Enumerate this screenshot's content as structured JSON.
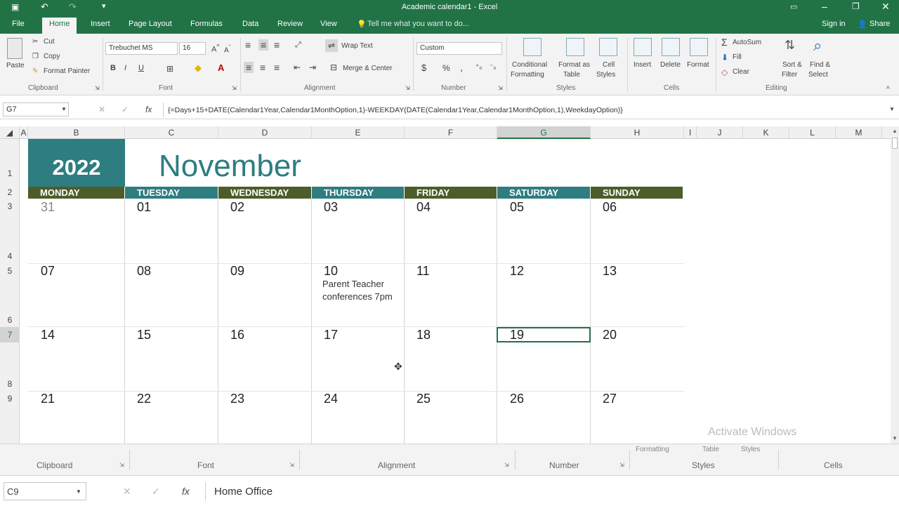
{
  "window": {
    "title": "Academic calendar1 - Excel"
  },
  "tabs": [
    "File",
    "Home",
    "Insert",
    "Page Layout",
    "Formulas",
    "Data",
    "Review",
    "View"
  ],
  "tell_me": "Tell me what you want to do...",
  "account": {
    "signin": "Sign in",
    "share": "Share"
  },
  "ribbon": {
    "clipboard": {
      "paste": "Paste",
      "cut": "Cut",
      "copy": "Copy",
      "format_painter": "Format Painter",
      "label": "Clipboard"
    },
    "font": {
      "name": "Trebuchet MS",
      "size": "16",
      "label": "Font",
      "bold": "B",
      "italic": "I",
      "underline": "U"
    },
    "alignment": {
      "wrap": "Wrap Text",
      "merge": "Merge & Center",
      "label": "Alignment"
    },
    "number": {
      "format": "Custom",
      "currency": "$",
      "percent": "%",
      "comma": ",",
      "label": "Number"
    },
    "styles": {
      "cond1": "Conditional",
      "cond2": "Formatting",
      "fmt1": "Format as",
      "fmt2": "Table",
      "cell1": "Cell",
      "cell2": "Styles",
      "label": "Styles"
    },
    "cells": {
      "insert": "Insert",
      "delete": "Delete",
      "format": "Format",
      "label": "Cells"
    },
    "editing": {
      "autosum": "AutoSum",
      "fill": "Fill",
      "clear": "Clear",
      "sort1": "Sort &",
      "sort2": "Filter",
      "find1": "Find &",
      "find2": "Select",
      "label": "Editing"
    }
  },
  "formula_bar": {
    "namebox": "G7",
    "formula": "{=Days+15+DATE(Calendar1Year,Calendar1MonthOption,1)-WEEKDAY(DATE(Calendar1Year,Calendar1MonthOption,1),WeekdayOption)}"
  },
  "columns": [
    "A",
    "B",
    "C",
    "D",
    "E",
    "F",
    "G",
    "H",
    "I",
    "J",
    "K",
    "L",
    "M"
  ],
  "rows": [
    "1",
    "2",
    "3",
    "4",
    "5",
    "6",
    "7",
    "8",
    "9"
  ],
  "calendar": {
    "year": "2022",
    "month": "November",
    "days": [
      "MONDAY",
      "TUESDAY",
      "WEDNESDAY",
      "THURSDAY",
      "FRIDAY",
      "SATURDAY",
      "SUNDAY"
    ],
    "day_colors": [
      "#4d5d29",
      "#2e7d80",
      "#4d5d29",
      "#2e7d80",
      "#4d5d29",
      "#2e7d80",
      "#4d5d29"
    ],
    "weeks": [
      [
        "31",
        "01",
        "02",
        "03",
        "04",
        "05",
        "06"
      ],
      [
        "07",
        "08",
        "09",
        "10",
        "11",
        "12",
        "13"
      ],
      [
        "14",
        "15",
        "16",
        "17",
        "18",
        "19",
        "20"
      ],
      [
        "21",
        "22",
        "23",
        "24",
        "25",
        "26",
        "27"
      ]
    ],
    "note": "Parent Teacher conferences 7pm"
  },
  "watermark": "Activate Windows",
  "bottom": {
    "groups": [
      "Clipboard",
      "Font",
      "Alignment",
      "Number",
      "Styles",
      "Cells"
    ],
    "partial": [
      "Formatting",
      "Table",
      "Styles"
    ],
    "namebox": "C9",
    "value": "Home Office"
  },
  "colors": {
    "excel_green": "#217346",
    "teal": "#2e7d80",
    "olive": "#4d5d29"
  }
}
